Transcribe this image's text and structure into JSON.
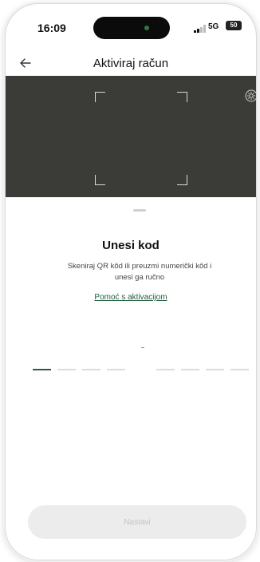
{
  "status_bar": {
    "time": "16:09",
    "network": "5G",
    "battery": "50",
    "icons": [
      "signal-icon",
      "battery-icon"
    ]
  },
  "nav": {
    "title": "Aktiviraj račun",
    "back_icon": "arrow-left-icon"
  },
  "camera": {
    "flash_icon": "sun-icon"
  },
  "sheet": {
    "title": "Unesi kod",
    "description": "Skeniraj QR kôd ili preuzmi numerički kôd i unesi ga ručno",
    "help_link": "Pomoć s aktivacijom",
    "code_length": 8,
    "continue_label": "Nastavi"
  },
  "colors": {
    "accent": "#2a5d45",
    "camera_bg": "#3b3b37",
    "disabled_bg": "#ececec",
    "disabled_text": "#c4c4c4"
  }
}
